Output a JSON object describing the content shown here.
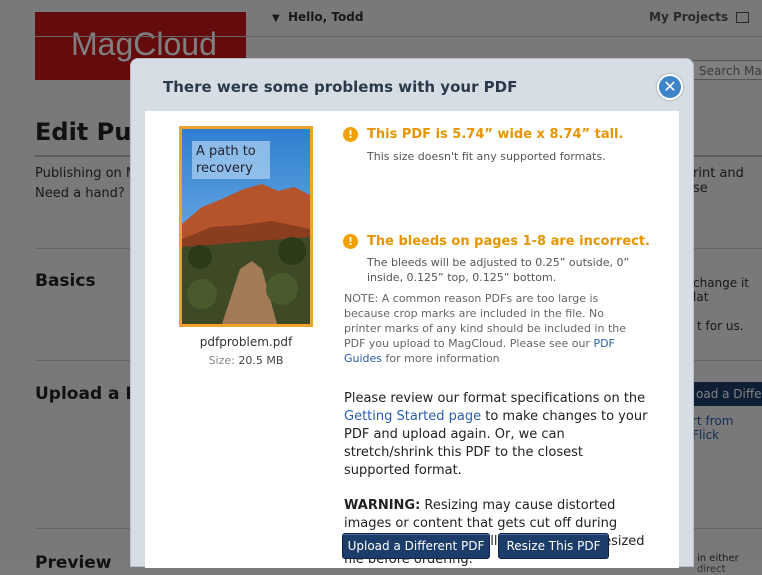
{
  "background": {
    "logo_text": "MagCloud",
    "greeting": "Hello, Todd",
    "nav_my_projects": "My Projects",
    "search_placeholder": "Search Mag",
    "page_title": "Edit Pub",
    "publishing_text": "Publishing on M",
    "need_hand": "Need a hand?",
    "right_text_1": "rint and se",
    "right_text_2": "change it lat",
    "right_text_3": "t for us.",
    "sections": [
      "Basics",
      "Upload a PD",
      "Preview"
    ],
    "upload_button_partial": "oad a Differe",
    "flickr_link_partial": "rt from Flick",
    "small_text_partial": "in either direct"
  },
  "dialog": {
    "title": "There were some problems with your PDF",
    "close_label": "✕",
    "thumbnail_caption": "A path to recovery",
    "file_name": "pdfproblem.pdf",
    "file_size_label": "Size:",
    "file_size_value": "20.5 MB",
    "issues": [
      {
        "title": "This PDF is 5.74” wide x 8.74” tall.",
        "description": "This size doesn't fit any supported formats."
      },
      {
        "title": "The bleeds on pages 1-8 are incorrect.",
        "description": "The bleeds will be adjusted to 0.25” outside, 0” inside, 0.125” top, 0.125” bottom."
      }
    ],
    "note_before": "NOTE: A common reason PDFs are too large is because crop marks are included in the file. No printer marks of any kind should be included in the PDF you upload to MagCloud. Please see our ",
    "note_link": "PDF Guides",
    "note_after": " for more information",
    "review_before": "Please review our format specifications on the ",
    "review_link": "Getting Started page",
    "review_after": " to make changes to your PDF and upload again. Or, we can stretch/shrink this PDF to the closest supported format.",
    "warning_label": "WARNING:",
    "warning_text": " Resizing may cause distorted images or content that gets cut off during printing. Please carefully preview your resized file before ordering.",
    "buttons": {
      "upload_different": "Upload a Different PDF",
      "resize": "Resize This PDF"
    }
  },
  "colors": {
    "accent_orange": "#e69500",
    "button_navy": "#1c3c6a",
    "link_blue": "#2a5db0",
    "brand_red": "#c8161d"
  },
  "icons": {
    "warning": "exclamation-circle-icon",
    "close": "close-x-icon",
    "mail": "envelope-icon"
  }
}
